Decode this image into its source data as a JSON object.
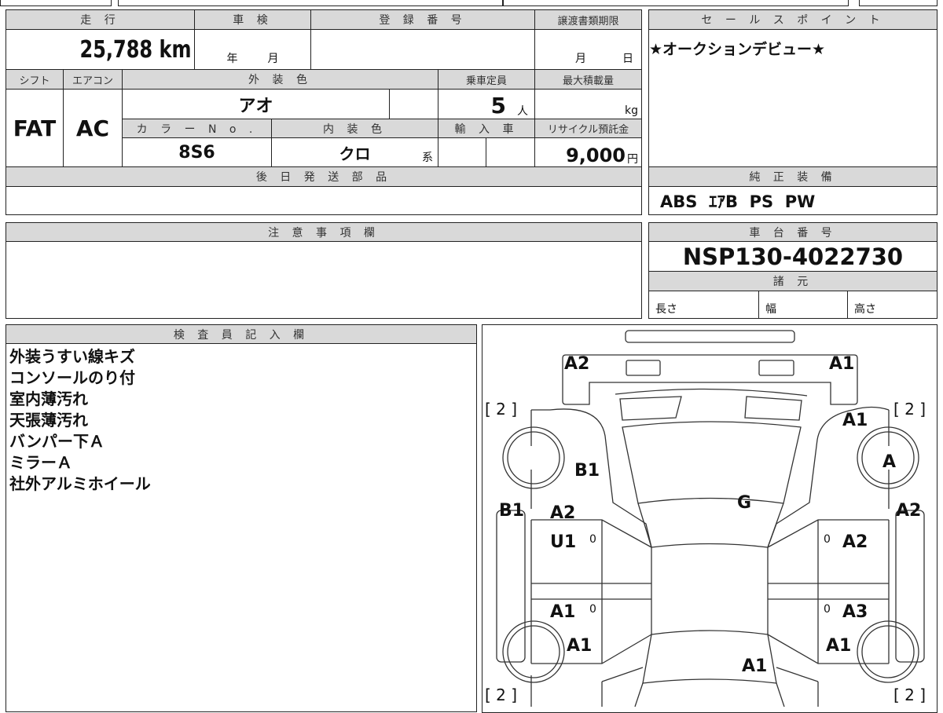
{
  "vehicle": {
    "mileage_header": "走 行",
    "mileage": "25,788",
    "mileage_unit": "km",
    "inspection_header": "車 検",
    "inspection_year": "年",
    "inspection_month": "月",
    "registration_header": "登 録 番 号",
    "transfer_header": "譲渡書類期限",
    "transfer_month": "月",
    "transfer_day": "日",
    "shift_header": "シフト",
    "shift": "FAT",
    "ac_header": "エアコン",
    "ac": "AC",
    "exterior_header": "外 装 色",
    "exterior": "アオ",
    "capacity_header": "乗車定員",
    "capacity": "5",
    "capacity_unit": "人",
    "load_header": "最大積載量",
    "load_unit": "kg",
    "color_no_header": "カ ラ ー N o .",
    "color_no": "8S6",
    "interior_header": "内 装 色",
    "interior": "クロ",
    "interior_suffix": "系",
    "import_header": "輸 入 車",
    "recycle_header": "リサイクル預託金",
    "recycle": "9,000",
    "recycle_unit": "円",
    "later_parts_header": "後 日 発 送 部 品"
  },
  "sales_point": {
    "header": "セ ー ル ス ポ イ ン ト",
    "text": "★オークションデビュー★"
  },
  "equipment": {
    "header": "純 正 装 備",
    "text": "ABS  ｴｱB  PS  PW"
  },
  "notes": {
    "header": "注 意 事 項 欄"
  },
  "chassis": {
    "header": "車 台 番 号",
    "number": "NSP130-4022730",
    "spec_header": "諸 元",
    "length": "長さ",
    "width": "幅",
    "height": "高さ"
  },
  "inspector": {
    "header": "検 査 員 記 入 欄",
    "lines": [
      "外装うすい線キズ",
      "コンソールのり付",
      "室内薄汚れ",
      "天張薄汚れ",
      "バンパー下Ａ",
      "ミラーＡ",
      "社外アルミホイール"
    ]
  },
  "diagram": {
    "marks": [
      "A2",
      "A1",
      "[ 2 ]",
      "[ 2 ]",
      "A1",
      "A",
      "B1",
      "G",
      "B1",
      "A2",
      "A2",
      "U1",
      "0",
      "0",
      "A2",
      "A1",
      "0",
      "0",
      "A3",
      "A1",
      "A1",
      "A1",
      "[ 2 ]",
      "[ 2 ]"
    ]
  }
}
